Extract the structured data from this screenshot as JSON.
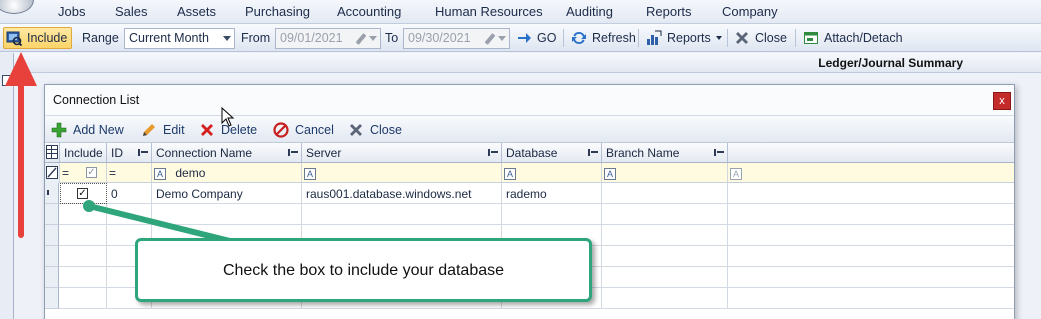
{
  "menu": [
    "Jobs",
    "Sales",
    "Assets",
    "Purchasing",
    "Accounting",
    "Human Resources",
    "Auditing",
    "Reports",
    "Company"
  ],
  "toolbar": {
    "include_label": "Include",
    "range_label": "Range",
    "range_value": "Current Month",
    "from_label": "From",
    "from_value": "09/01/2021",
    "to_label": "To",
    "to_value": "09/30/2021",
    "go_label": "GO",
    "refresh_label": "Refresh",
    "reports_label": "Reports",
    "close_label": "Close",
    "attach_label": "Attach/Detach"
  },
  "header_title": "Ledger/Journal Summary",
  "dialog": {
    "title": "Connection List",
    "close_glyph": "x",
    "toolbar": {
      "add_new": "Add New",
      "edit": "Edit",
      "delete": "Delete",
      "cancel": "Cancel",
      "close": "Close"
    },
    "columns": [
      "Include",
      "ID",
      "Connection Name",
      "Server",
      "Database",
      "Branch Name"
    ],
    "filter": {
      "include_op": "=",
      "id_op": "=",
      "connection_name": "demo"
    },
    "rows": [
      {
        "include": true,
        "id": "0",
        "connection_name": "Demo Company",
        "server": "raus001.database.windows.net",
        "database": "rademo",
        "branch_name": ""
      }
    ]
  },
  "callout": {
    "text": "Check the box to include your database"
  },
  "colors": {
    "accent_highlight": "#fbd46a",
    "callout_border": "#2fa57b",
    "arrow_red": "#e8403a"
  }
}
